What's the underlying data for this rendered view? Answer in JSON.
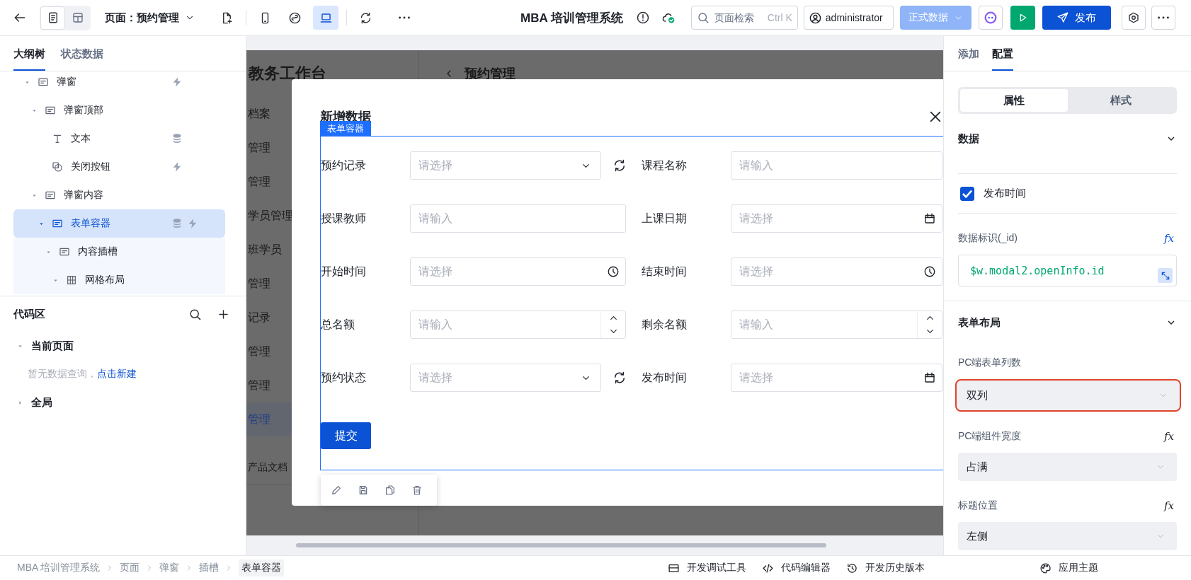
{
  "topbar": {
    "view_modes": [
      {
        "kind": "page",
        "selected": true
      },
      {
        "kind": "layout",
        "selected": false
      }
    ],
    "page_selector": "页面：预约管理",
    "devices": [
      {
        "kind": "phone",
        "selected": false
      },
      {
        "kind": "mini",
        "selected": false
      },
      {
        "kind": "desktop",
        "selected": true
      }
    ],
    "app_title": "MBA 培训管理系统",
    "search": {
      "placeholder": "页面检索",
      "shortcut": "Ctrl K"
    },
    "user": "administrator",
    "data_env": {
      "label": "正式数据",
      "disabled": true
    },
    "publish": "发布"
  },
  "outline": {
    "tabs": [
      {
        "label": "大纲树",
        "selected": true
      },
      {
        "label": "状态数据",
        "selected": false
      }
    ],
    "tree": [
      {
        "label": "弹窗",
        "kind": "container",
        "expanded": true,
        "selected": false,
        "bound": false,
        "events": true,
        "children": [
          {
            "label": "弹窗顶部",
            "kind": "container",
            "expanded": true,
            "selected": false,
            "bound": false,
            "events": false,
            "children": [
              {
                "label": "文本",
                "kind": "text",
                "selected": false,
                "bound": true,
                "events": false
              },
              {
                "label": "关闭按钮",
                "kind": "button",
                "selected": false,
                "bound": false,
                "events": true
              }
            ]
          },
          {
            "label": "弹窗内容",
            "kind": "container",
            "expanded": true,
            "selected": false,
            "bound": false,
            "events": false,
            "children": [
              {
                "label": "表单容器",
                "kind": "container",
                "expanded": true,
                "selected": true,
                "bound": true,
                "events": true,
                "children": [
                  {
                    "label": "内容插槽",
                    "kind": "container",
                    "expanded": true,
                    "selected": false,
                    "bound": false,
                    "events": false,
                    "children": [
                      {
                        "label": "网格布局",
                        "kind": "grid",
                        "expanded": true,
                        "selected": false,
                        "bound": false,
                        "events": false
                      }
                    ]
                  }
                ]
              }
            ]
          }
        ]
      }
    ]
  },
  "code_area": {
    "title": "代码区",
    "groups": [
      {
        "label": "当前页面",
        "expanded": true,
        "empty_text": "暂无数据查询，",
        "link": "点击新建"
      },
      {
        "label": "全局",
        "expanded": false
      }
    ]
  },
  "canvas": {
    "page_title": "教务工作台",
    "nav": [
      {
        "label": "档案",
        "selected": false
      },
      {
        "label": "管理",
        "selected": false
      },
      {
        "label": "管理",
        "selected": false
      },
      {
        "label": "学员管理",
        "selected": false
      },
      {
        "label": "班学员",
        "selected": false
      },
      {
        "label": "管理",
        "selected": false
      },
      {
        "label": "记录",
        "selected": false
      },
      {
        "label": "管理",
        "selected": false
      },
      {
        "label": "管理",
        "selected": false
      },
      {
        "label": "管理",
        "selected": true
      }
    ],
    "nav_footer": "产品文档",
    "header": "预约管理",
    "modal": {
      "title": "新增数据",
      "container_tag": "表单容器",
      "fields": [
        {
          "label": "预约记录",
          "kind": "select",
          "placeholder": "请选择",
          "refresh": true
        },
        {
          "label": "课程名称",
          "kind": "input",
          "placeholder": "请输入",
          "refresh": false
        },
        {
          "label": "授课教师",
          "kind": "input",
          "placeholder": "请输入",
          "refresh": false
        },
        {
          "label": "上课日期",
          "kind": "date",
          "placeholder": "请选择",
          "refresh": false
        },
        {
          "label": "开始时间",
          "kind": "time",
          "placeholder": "请选择",
          "refresh": false
        },
        {
          "label": "结束时间",
          "kind": "time",
          "placeholder": "请选择",
          "refresh": false
        },
        {
          "label": "总名额",
          "kind": "number",
          "placeholder": "请输入",
          "refresh": false
        },
        {
          "label": "剩余名额",
          "kind": "number",
          "placeholder": "请输入",
          "refresh": false
        },
        {
          "label": "预约状态",
          "kind": "select",
          "placeholder": "请选择",
          "refresh": true
        },
        {
          "label": "发布时间",
          "kind": "date",
          "placeholder": "请选择",
          "refresh": false
        }
      ],
      "submit": "提交"
    }
  },
  "config": {
    "tabs": [
      {
        "label": "添加",
        "selected": false
      },
      {
        "label": "配置",
        "selected": true
      }
    ],
    "segments": [
      {
        "label": "属性",
        "selected": true
      },
      {
        "label": "样式",
        "selected": false
      }
    ],
    "data_section": {
      "title": "数据",
      "expanded": true,
      "fields": [
        {
          "label": "发布时间",
          "checked": true
        }
      ],
      "id_label": "数据标识(_id)",
      "id_formula": "fx",
      "id_value": "$w.modal2.openInfo.id"
    },
    "layout_section": {
      "title": "表单布局",
      "expanded": true,
      "settings": [
        {
          "label": "PC端表单列数",
          "value": "双列",
          "focused": true
        },
        {
          "label": "PC端组件宽度",
          "value": "占满",
          "focused": false,
          "formula": "fx"
        },
        {
          "label": "标题位置",
          "value": "左侧",
          "focused": false,
          "formula": "fx"
        }
      ]
    }
  },
  "statusbar": {
    "breadcrumb": [
      {
        "label": "MBA 培训管理系统",
        "selected": false
      },
      {
        "label": "页面",
        "selected": false
      },
      {
        "label": "弹窗",
        "selected": false
      },
      {
        "label": "插槽",
        "selected": false
      },
      {
        "label": "表单容器",
        "selected": true
      }
    ],
    "tools": [
      {
        "kind": "debug",
        "label": "开发调试工具"
      },
      {
        "kind": "code",
        "label": "代码编辑器"
      },
      {
        "kind": "history",
        "label": "开发历史版本"
      }
    ],
    "theme": "应用主题"
  }
}
